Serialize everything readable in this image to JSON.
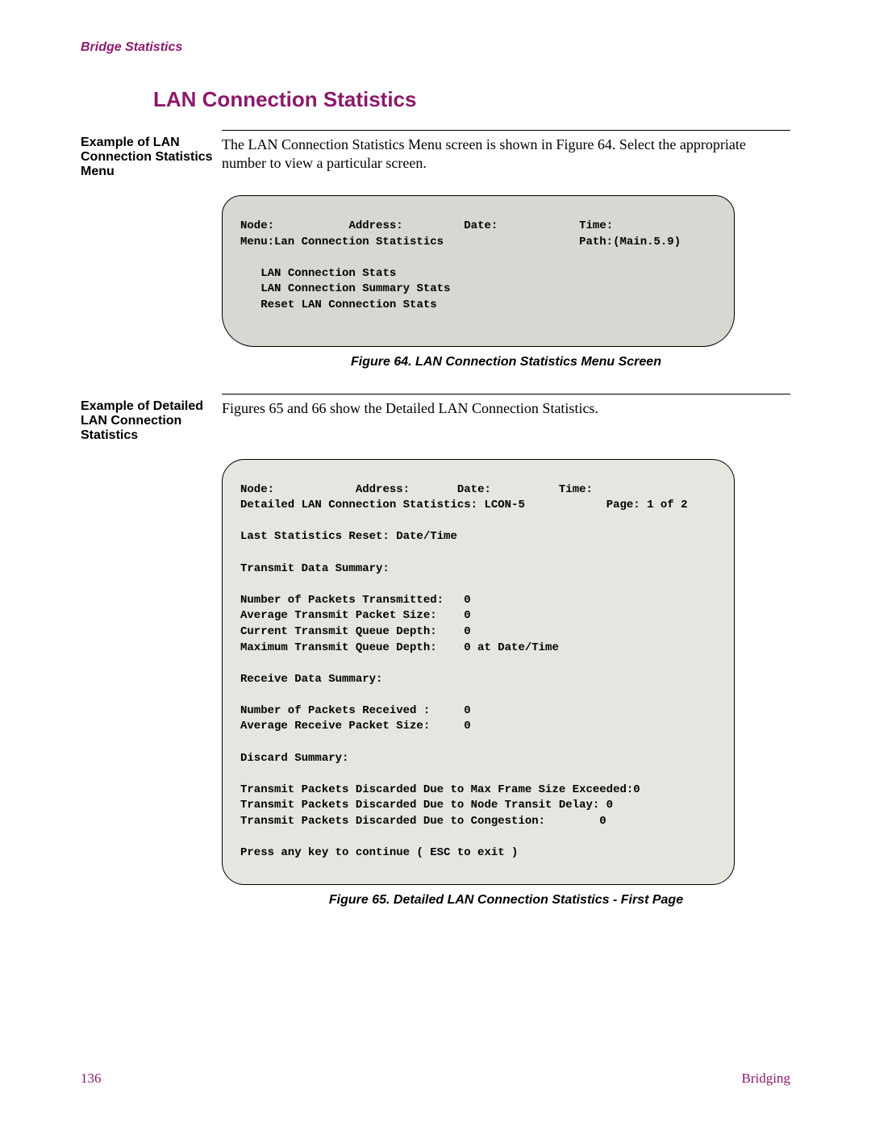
{
  "header": {
    "label": "Bridge Statistics"
  },
  "heading": "LAN Connection Statistics",
  "section1": {
    "side": "Example of LAN Connection Statistics Menu",
    "body": "The LAN Connection Statistics Menu screen is shown in Figure 64. Select the appropriate number to view a particular screen."
  },
  "fig64": {
    "node": "Node:",
    "address": "Address:",
    "date": "Date:",
    "time": "Time:",
    "menu": "Menu:Lan Connection Statistics",
    "path": "Path:(Main.5.9)",
    "item1": "LAN Connection Stats",
    "item2": "LAN Connection Summary Stats",
    "item3": "Reset LAN Connection Stats",
    "caption": "Figure 64. LAN Connection Statistics Menu Screen"
  },
  "section2": {
    "side": "Example of Detailed LAN Connection Statistics",
    "body": "Figures 65 and 66 show the Detailed LAN Connection Statistics."
  },
  "fig65": {
    "node": "Node:",
    "address": "Address:",
    "date": "Date:",
    "time": "Time:",
    "title": "Detailed LAN Connection Statistics: LCON-5",
    "pageinfo": "Page: 1 of 2",
    "reset": "Last Statistics Reset: Date/Time",
    "tx_header": "Transmit Data Summary:",
    "tx_pkts": "Number of Packets Transmitted:   0",
    "tx_avg": "Average Transmit Packet Size:    0",
    "tx_curq": "Current Transmit Queue Depth:    0",
    "tx_maxq": "Maximum Transmit Queue Depth:    0 at Date/Time",
    "rx_header": "Receive Data Summary:",
    "rx_pkts": "Number of Packets Received :     0",
    "rx_avg": "Average Receive Packet Size:     0",
    "disc_header": "Discard Summary:",
    "disc1": "Transmit Packets Discarded Due to Max Frame Size Exceeded:0",
    "disc2": "Transmit Packets Discarded Due to Node Transit Delay: 0",
    "disc3": "Transmit Packets Discarded Due to Congestion:        0",
    "prompt": "Press any key to continue ( ESC to exit )",
    "caption": "Figure 65. Detailed LAN Connection Statistics - First Page"
  },
  "footer": {
    "page_number": "136",
    "label": "Bridging"
  }
}
